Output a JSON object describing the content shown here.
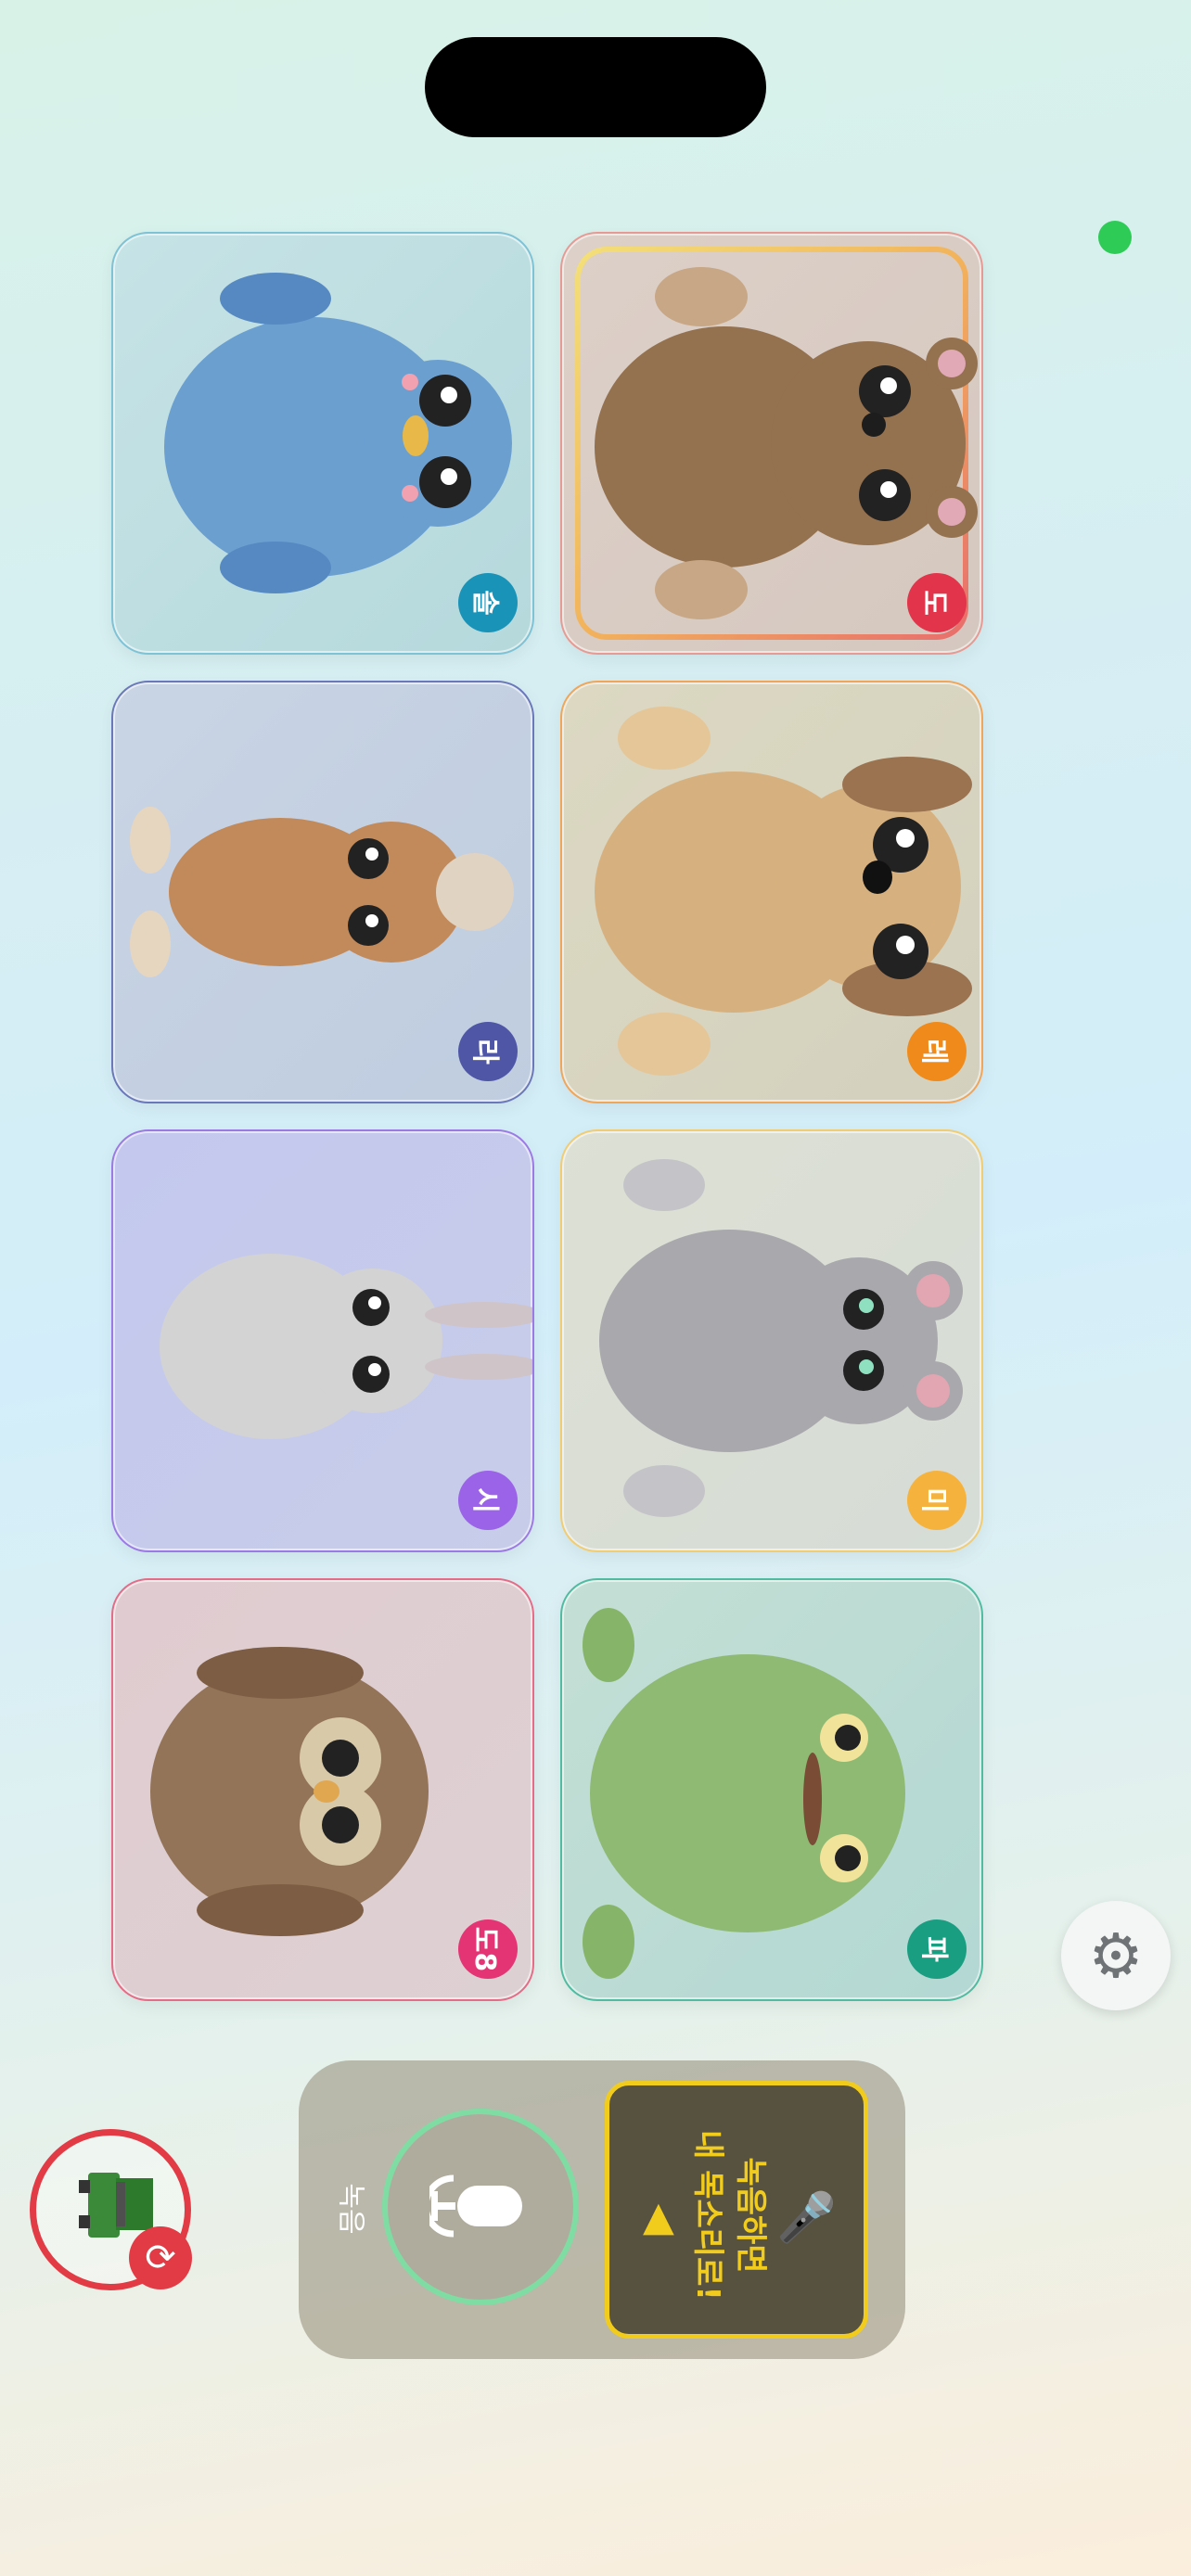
{
  "cards": [
    {
      "animal": "penguin",
      "note": "솔",
      "note_color": "#1a93b8"
    },
    {
      "animal": "bear",
      "note": "도",
      "note_color": "#e2344a"
    },
    {
      "animal": "squirrel",
      "note": "라",
      "note_color": "#4f56a6"
    },
    {
      "animal": "dog",
      "note": "레",
      "note_color": "#f08a1a"
    },
    {
      "animal": "rabbit",
      "note": "시",
      "note_color": "#9b63e8"
    },
    {
      "animal": "mouse",
      "note": "미",
      "note_color": "#f5b33e"
    },
    {
      "animal": "owl",
      "note": "도8",
      "note_color": "#e53473"
    },
    {
      "animal": "frog",
      "note": "파",
      "note_color": "#1a9e82"
    }
  ],
  "selected_card": "bear",
  "recorder": {
    "label": "녹음",
    "message_line1": "녹음하면",
    "message_line2": "내 목소리로!",
    "mic_icon": "microphone-icon",
    "play_icon": "play-icon"
  },
  "settings_icon": "gear-icon",
  "theme_switch_icon": "train-toy-icon"
}
